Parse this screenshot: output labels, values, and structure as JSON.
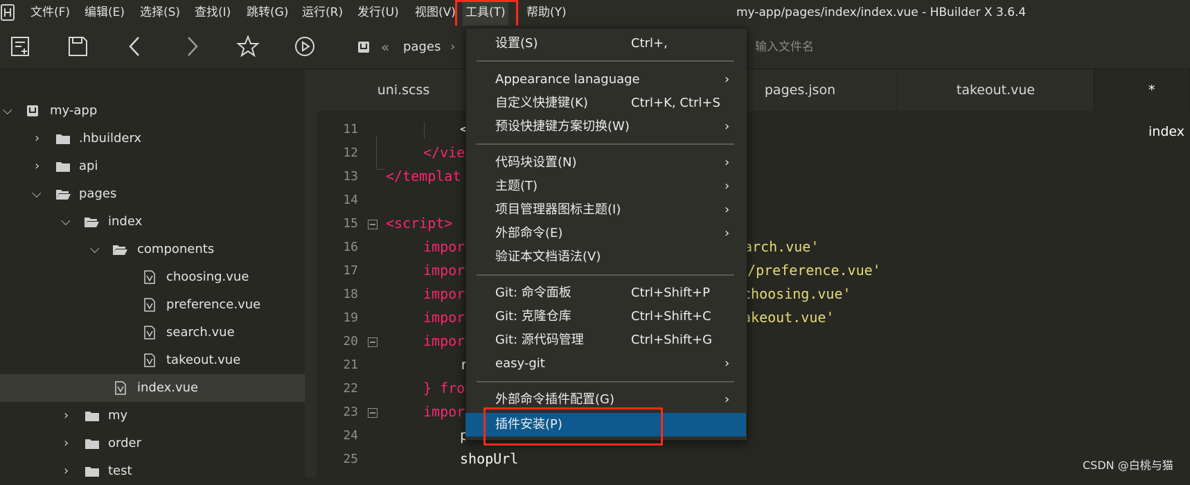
{
  "menubar": {
    "items": [
      "文件(F)",
      "编辑(E)",
      "选择(S)",
      "查找(I)",
      "跳转(G)",
      "运行(R)",
      "发行(U)",
      "视图(V)",
      "工具(T)",
      "帮助(Y)"
    ],
    "window_title": "my-app/pages/index/index.vue - HBuilder X 3.6.4"
  },
  "toolbar": {
    "icons": [
      "new-file-icon",
      "save-icon",
      "back-icon",
      "forward-icon",
      "star-icon",
      "run-icon"
    ],
    "breadcrumb": "pages",
    "file_search_placeholder": "输入文件名"
  },
  "sidebar": {
    "items": [
      {
        "label": "my-app",
        "icon": "project-icon"
      },
      {
        "label": ".hbuilderx",
        "icon": "folder-icon"
      },
      {
        "label": "api",
        "icon": "folder-icon"
      },
      {
        "label": "pages",
        "icon": "folder-open-icon"
      },
      {
        "label": "index",
        "icon": "folder-open-icon"
      },
      {
        "label": "components",
        "icon": "folder-open-icon"
      },
      {
        "label": "choosing.vue",
        "icon": "vue-file-icon"
      },
      {
        "label": "preference.vue",
        "icon": "vue-file-icon"
      },
      {
        "label": "search.vue",
        "icon": "vue-file-icon"
      },
      {
        "label": "takeout.vue",
        "icon": "vue-file-icon"
      },
      {
        "label": "index.vue",
        "icon": "vue-file-icon",
        "selected": true
      },
      {
        "label": "my",
        "icon": "folder-icon"
      },
      {
        "label": "order",
        "icon": "folder-icon"
      },
      {
        "label": "test",
        "icon": "folder-icon"
      }
    ]
  },
  "tabs": [
    "uni.scss",
    "pages.json",
    "takeout.vue",
    "* index"
  ],
  "editor": {
    "line_numbers": [
      "11",
      "12",
      "13",
      "14",
      "15",
      "16",
      "17",
      "18",
      "19",
      "20",
      "21",
      "22",
      "23",
      "24",
      "25"
    ],
    "lines": [
      "<",
      "</vie",
      "</templat",
      "",
      "<script>",
      "impor",
      "impor",
      "impor",
      "impor",
      "impor",
      "r",
      "} fro",
      "impor",
      "preferenceUrl",
      "shopUrl"
    ],
    "right_fragments": [
      "arch.vue'",
      "s/preference.vue'",
      "choosing.vue'",
      "akeout.vue'"
    ]
  },
  "dropdown": {
    "items": [
      {
        "label": "设置(S)",
        "shortcut": "Ctrl+,"
      },
      {
        "label": "Appearance lanaguage",
        "submenu": true
      },
      {
        "label": "自定义快捷键(K)",
        "shortcut": "Ctrl+K, Ctrl+S"
      },
      {
        "label": "预设快捷键方案切换(W)",
        "submenu": true
      },
      {
        "label": "代码块设置(N)",
        "submenu": true
      },
      {
        "label": "主题(T)",
        "submenu": true
      },
      {
        "label": "项目管理器图标主题(I)",
        "submenu": true
      },
      {
        "label": "外部命令(E)",
        "submenu": true
      },
      {
        "label": "验证本文档语法(V)"
      },
      {
        "label": "Git: 命令面板",
        "shortcut": "Ctrl+Shift+P"
      },
      {
        "label": "Git: 克隆仓库",
        "shortcut": "Ctrl+Shift+C"
      },
      {
        "label": "Git: 源代码管理",
        "shortcut": "Ctrl+Shift+G"
      },
      {
        "label": "easy-git",
        "submenu": true
      },
      {
        "label": "外部命令插件配置(G)",
        "submenu": true
      },
      {
        "label": "插件安装(P)",
        "highlighted": true
      }
    ]
  },
  "watermark": "CSDN @白桃与猫",
  "colors": {
    "background": "#272822",
    "highlight_box": "#ff2a1d",
    "menu_hover": "#0e5a8e",
    "keyword": "#f92672",
    "string": "#e6db74"
  }
}
